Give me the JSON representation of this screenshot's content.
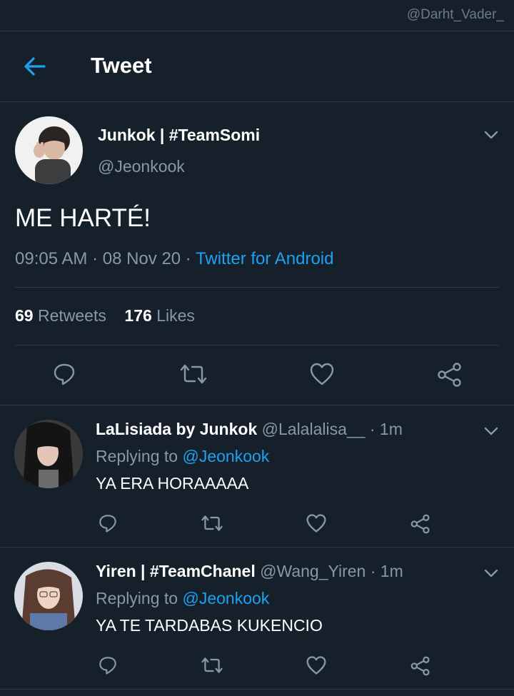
{
  "watermark": "@Darht_Vader_",
  "header": {
    "title": "Tweet",
    "back_icon": "arrow-left-icon"
  },
  "accent_color": "#1da1f2",
  "main_tweet": {
    "author_name": "Junkok | #TeamSomi",
    "author_handle": "@Jeonkook",
    "text": "ME HARTÉ!",
    "time": "09:05 AM",
    "date": "08 Nov 20",
    "source": "Twitter for Android",
    "retweets_count": "69",
    "retweets_label": "Retweets",
    "likes_count": "176",
    "likes_label": "Likes",
    "actions": [
      "reply-icon",
      "retweet-icon",
      "like-icon",
      "share-icon"
    ]
  },
  "replies": [
    {
      "author_name": "LaLisiada by Junkok",
      "author_handle": "@Lalalalisa__",
      "time_ago": "1m",
      "replying_prefix": "Replying to",
      "replying_to": "@Jeonkook",
      "text": "YA ERA HORAAAAA"
    },
    {
      "author_name": "Yiren | #TeamChanel",
      "author_handle": "@Wang_Yiren",
      "time_ago": "1m",
      "replying_prefix": "Replying to",
      "replying_to": "@Jeonkook",
      "text": "YA TE TARDABAS KUKENCIO"
    }
  ]
}
